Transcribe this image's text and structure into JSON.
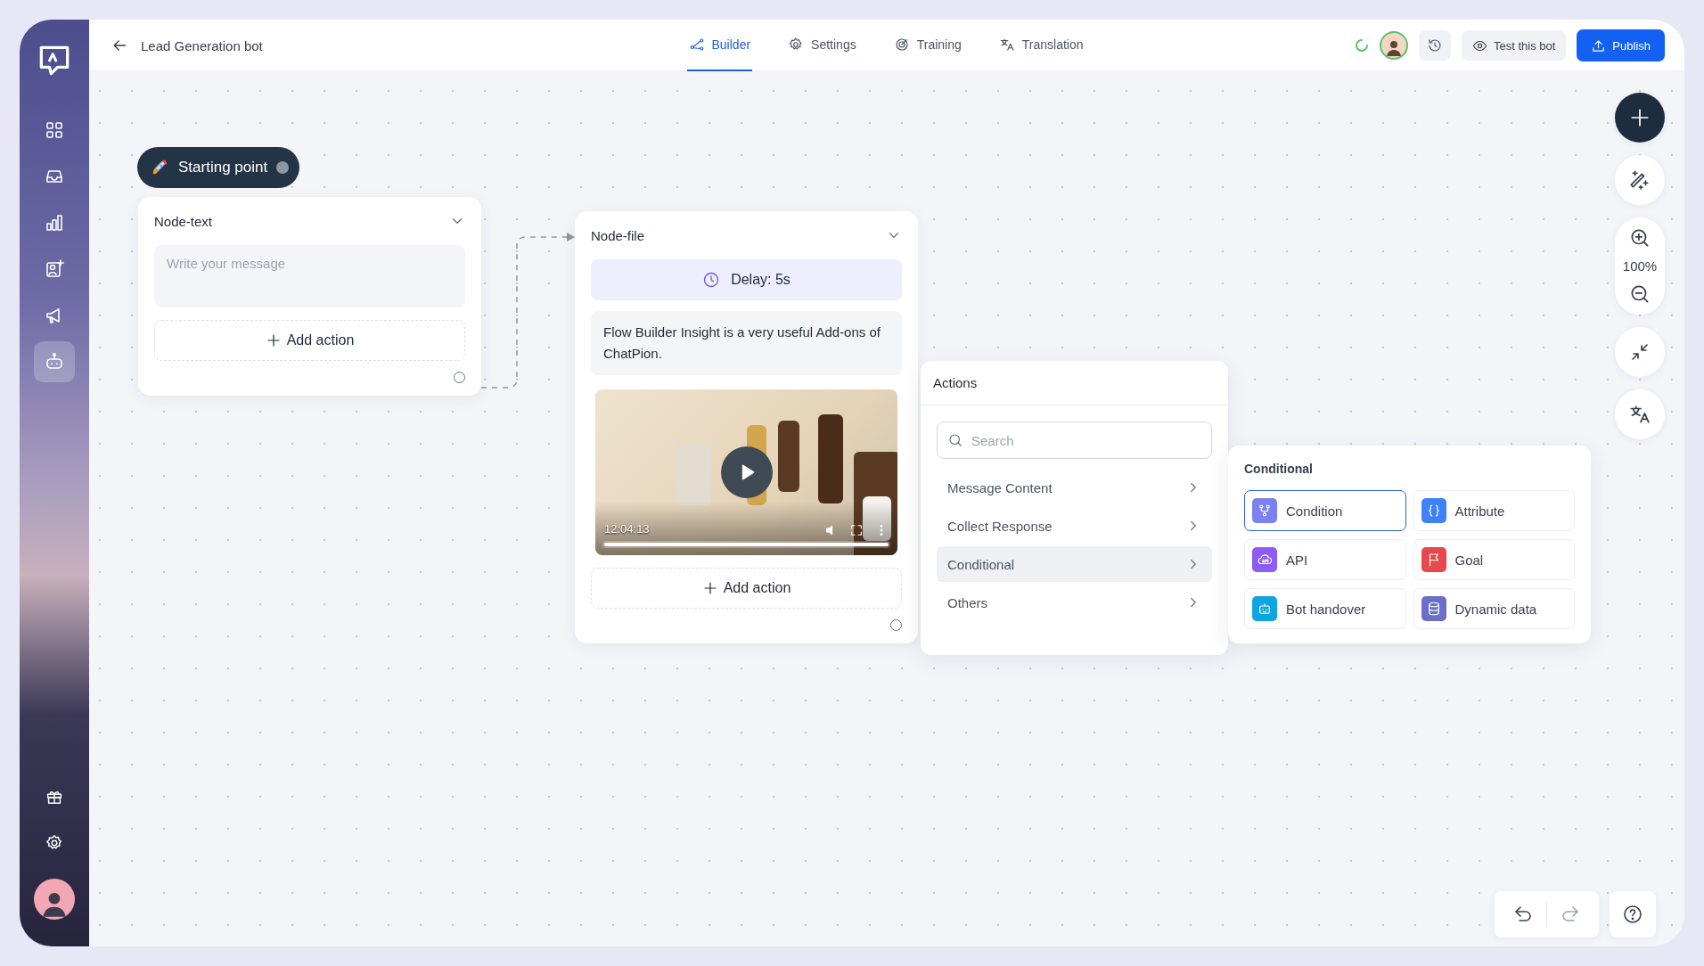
{
  "sidebar": {
    "items": [
      {
        "selected": false
      },
      {
        "selected": false
      },
      {
        "selected": false
      },
      {
        "selected": false
      },
      {
        "selected": false
      },
      {
        "selected": true
      }
    ],
    "bottom_items": [
      {
        "selected": false
      },
      {
        "selected": false
      }
    ]
  },
  "header": {
    "title": "Lead Generation bot",
    "tabs": [
      {
        "label": "Builder",
        "selected": true
      },
      {
        "label": "Settings",
        "selected": false
      },
      {
        "label": "Training",
        "selected": false
      },
      {
        "label": "Translation",
        "selected": false
      }
    ],
    "test_button": "Test this bot",
    "publish_button": "Publish"
  },
  "canvas": {
    "start_node": {
      "label": "Starting point"
    },
    "nodes": [
      {
        "kind": "text",
        "title": "Node-text",
        "placeholder": "Write your message",
        "add_action": "Add action"
      },
      {
        "kind": "file",
        "title": "Node-file",
        "delay": "Delay: 5s",
        "message": "Flow Builder Insight is a very useful Add-ons of ChatPion.",
        "video_time": "12:04:13",
        "video_progress": {
          "level": 1
        },
        "add_action": "Add action"
      }
    ],
    "actions_menu": {
      "title": "Actions",
      "search_placeholder": "Search",
      "categories": [
        {
          "label": "Message Content",
          "selected": false
        },
        {
          "label": "Collect Response",
          "selected": false
        },
        {
          "label": "Conditional",
          "selected": true
        },
        {
          "label": "Others",
          "selected": false
        }
      ]
    },
    "submenu": {
      "title": "Conditional",
      "items": [
        {
          "label": "Condition",
          "selected": true,
          "color": "#7b80f2"
        },
        {
          "label": "Attribute",
          "selected": false,
          "color": "#3d82f6"
        },
        {
          "label": "API",
          "selected": false,
          "color": "#8b5cf6"
        },
        {
          "label": "Goal",
          "selected": false,
          "color": "#e5484d"
        },
        {
          "label": "Bot handover",
          "selected": false,
          "color": "#0ea5e0"
        },
        {
          "label": "Dynamic data",
          "selected": false,
          "color": "#6c6fc8"
        }
      ]
    },
    "zoom_level": "100%"
  }
}
